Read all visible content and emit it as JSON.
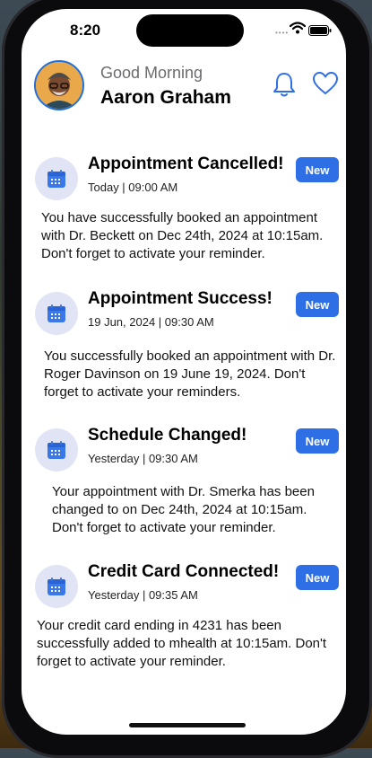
{
  "status_bar": {
    "time": "8:20"
  },
  "header": {
    "greeting": "Good Morning",
    "user_name": "Aaron Graham"
  },
  "icons": {
    "notifications": "bell-icon",
    "favorites": "heart-icon",
    "notification_type": "calendar-icon"
  },
  "colors": {
    "accent": "#2f6fe6",
    "icon_bg": "#e1e4f4",
    "calendar": "#3a78e8",
    "secondary_text": "#6c6c70"
  },
  "notifications": [
    {
      "title": "Appointment Cancelled!",
      "meta": "Today | 09:00 AM",
      "badge": "New",
      "body": "You have successfully booked an appointment with Dr. Beckett on Dec 24th, 2024 at 10:15am. Don't forget to activate your reminder."
    },
    {
      "title": "Appointment Success!",
      "meta": "19 Jun, 2024 | 09:30 AM",
      "badge": "New",
      "body": "You successfully booked an appointment with Dr. Roger Davinson on 19 June 19, 2024. Don't forget to activate your reminders."
    },
    {
      "title": "Schedule Changed!",
      "meta": "Yesterday | 09:30 AM",
      "badge": "New",
      "body": "Your appointment with Dr. Smerka has been changed to  on Dec 24th, 2024 at 10:15am. Don't forget to activate your reminder."
    },
    {
      "title": "Credit Card Connected!",
      "meta": "Yesterday | 09:35 AM",
      "badge": "New",
      "body": "Your credit card ending in 4231 has been successfully added to mhealth at 10:15am. Don't forget to activate your reminder."
    }
  ]
}
